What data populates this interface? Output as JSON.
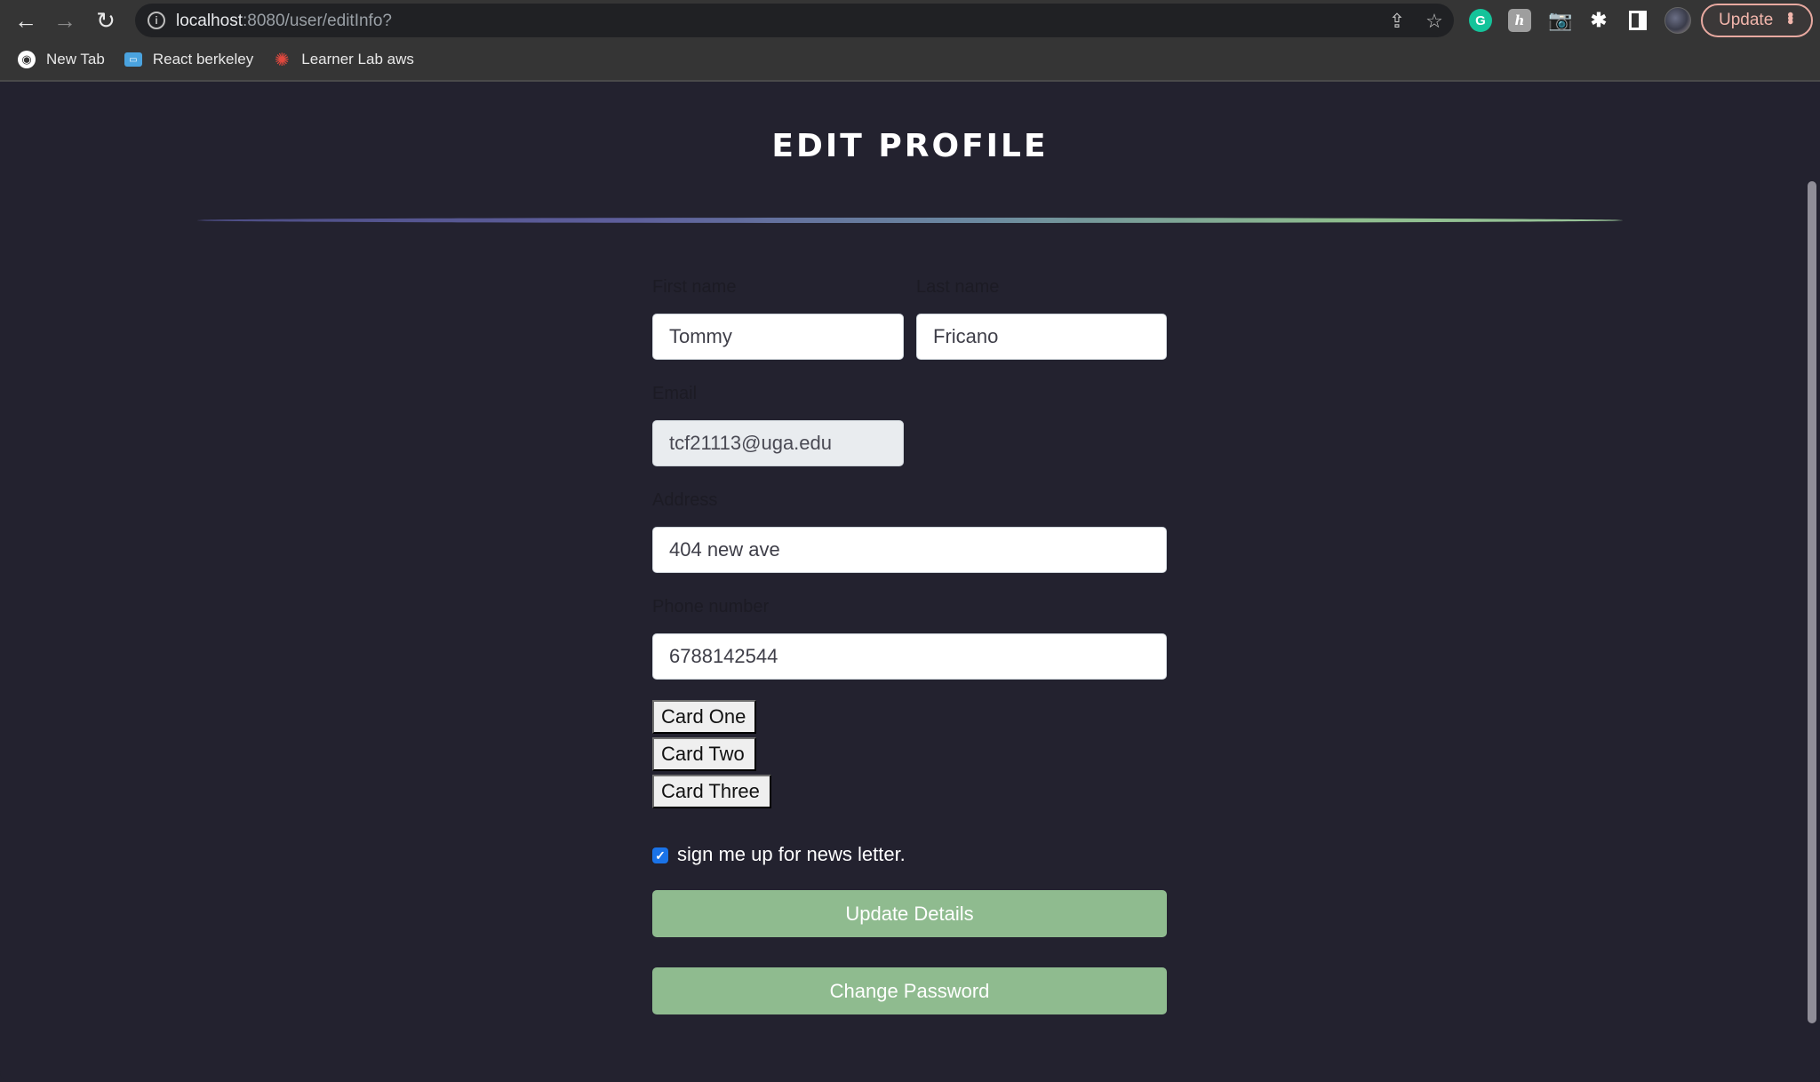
{
  "browser": {
    "url_host": "localhost",
    "url_rest": ":8080/user/editInfo?",
    "update_label": "Update",
    "bookmarks": [
      {
        "label": "New Tab",
        "icon": "globe-icon"
      },
      {
        "label": "React berkeley",
        "icon": "monitor-icon"
      },
      {
        "label": "Learner Lab aws",
        "icon": "canvas-icon"
      }
    ],
    "extensions": [
      "grammarly-icon",
      "honey-icon",
      "camera-icon",
      "puzzle-icon",
      "side-panel-icon"
    ],
    "icons": {
      "back": "←",
      "forward": "→",
      "reload": "↻",
      "info": "i",
      "share": "⇪",
      "star": "☆",
      "grammarly": "G",
      "honey": "h",
      "camera": "📷",
      "puzzle": "✱",
      "menu": "⋮",
      "globe": "◉",
      "monitor": "▭",
      "canvas": "✺",
      "check": "✓"
    }
  },
  "page": {
    "title": "EDIT PROFILE",
    "form": {
      "first_name": {
        "label": "First name",
        "value": "Tommy"
      },
      "last_name": {
        "label": "Last name",
        "value": "Fricano"
      },
      "email": {
        "label": "Email",
        "value": "tcf21113@uga.edu",
        "disabled": true
      },
      "address": {
        "label": "Address",
        "value": "404 new ave"
      },
      "phone": {
        "label": "Phone number",
        "value": "6788142544"
      },
      "cards": [
        "Card One",
        "Card Two",
        "Card Three"
      ],
      "newsletter": {
        "label": "sign me up for news letter.",
        "checked": true
      },
      "update_button": "Update Details",
      "change_password_button": "Change Password"
    }
  },
  "colors": {
    "page_bg": "#23222f",
    "button_green": "#8fbb8f",
    "divider_start": "#4d4d85",
    "divider_end": "#9ac69a",
    "checkbox_blue": "#1a73e8"
  }
}
